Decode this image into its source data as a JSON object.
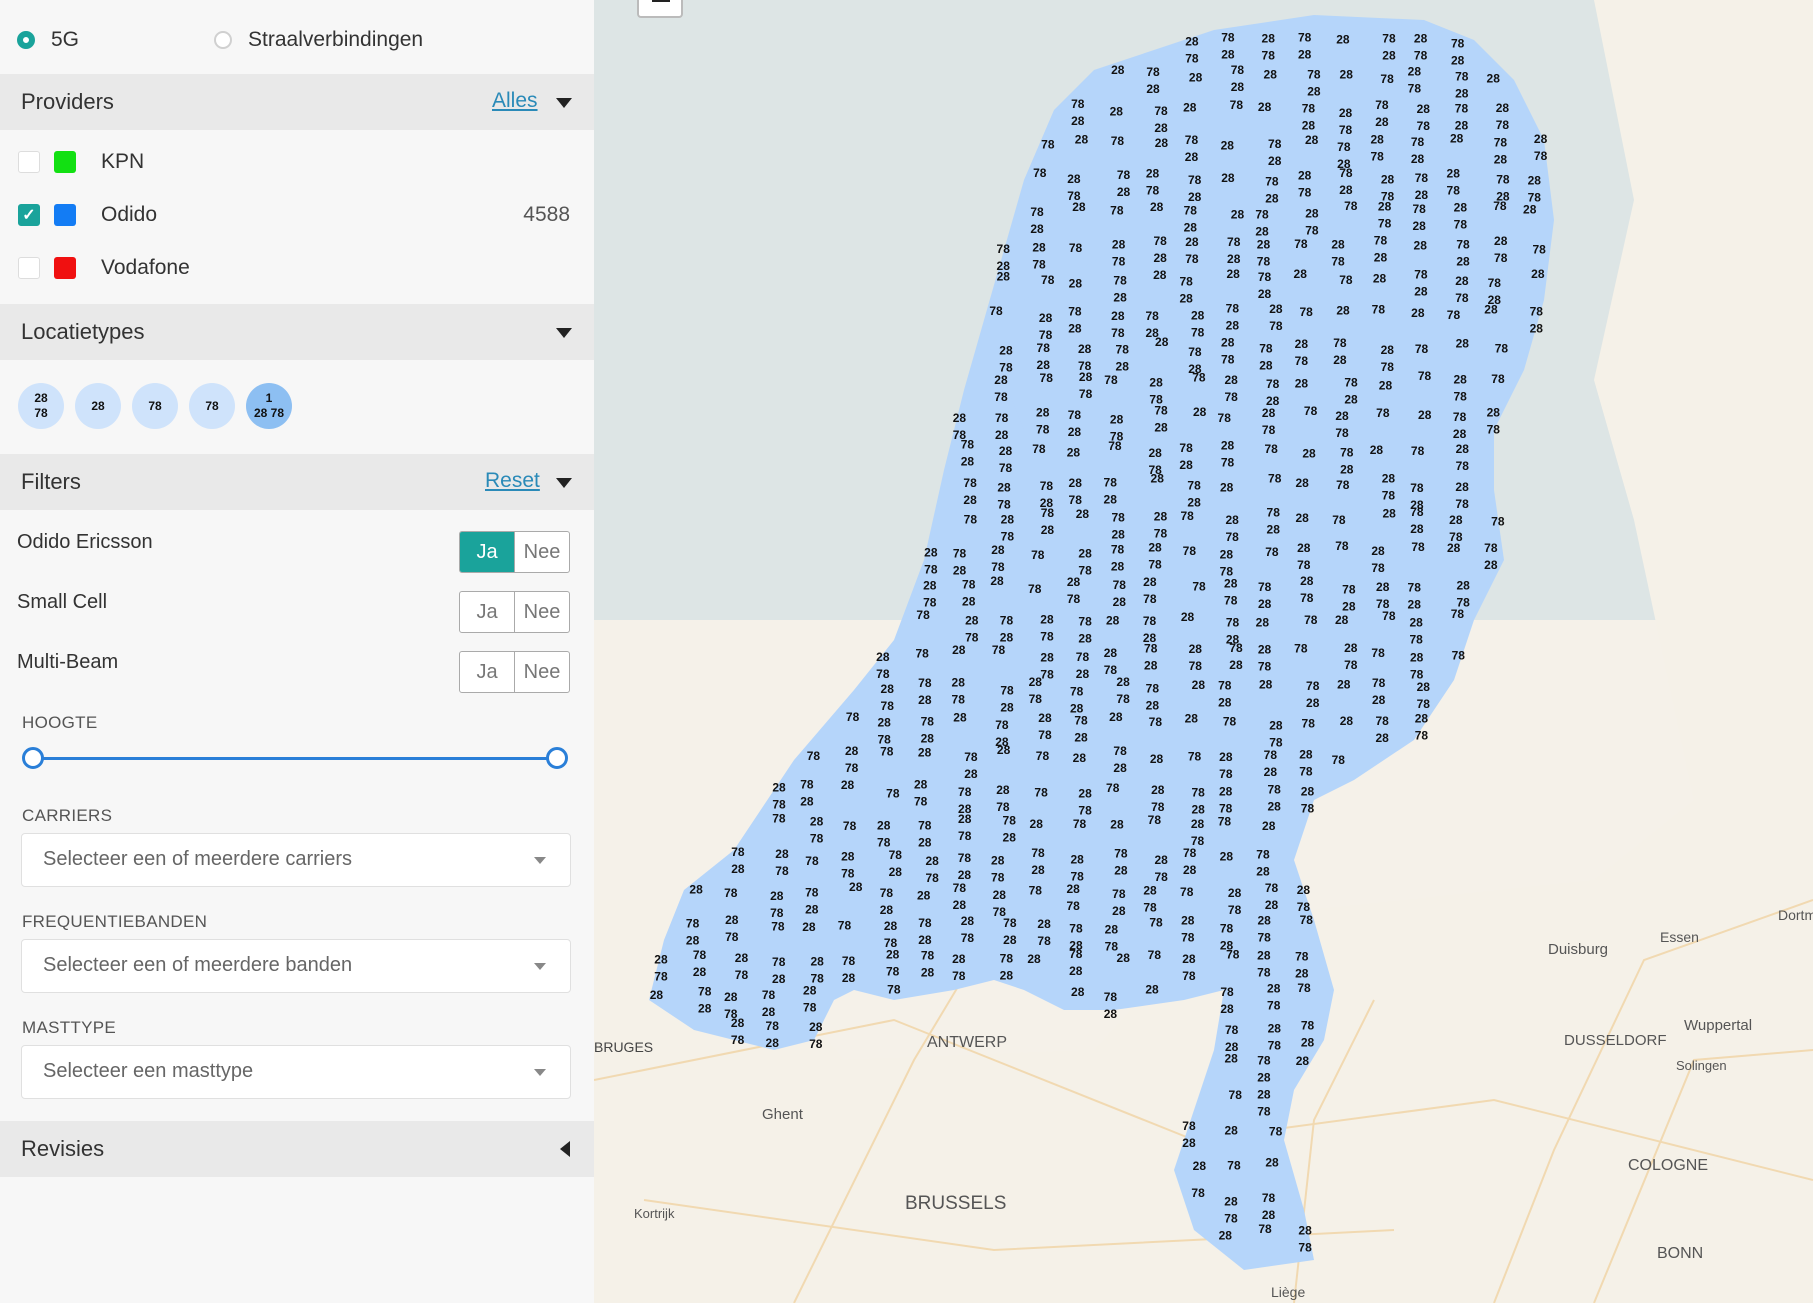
{
  "view": {
    "options": [
      "5G",
      "Straalverbindingen"
    ],
    "selected": "5G"
  },
  "providers": {
    "title": "Providers",
    "link": "Alles",
    "items": [
      {
        "label": "KPN",
        "color": "#12e012",
        "checked": false,
        "count": ""
      },
      {
        "label": "Odido",
        "color": "#137cf4",
        "checked": true,
        "count": "4588"
      },
      {
        "label": "Vodafone",
        "color": "#f01010",
        "checked": false,
        "count": ""
      }
    ]
  },
  "locatietypes": {
    "title": "Locatietypes",
    "items": [
      {
        "top": "28",
        "bottom": "78"
      },
      {
        "top": "28",
        "bottom": ""
      },
      {
        "top": "78",
        "bottom": ""
      },
      {
        "top": "78",
        "bottom": ""
      },
      {
        "top": "1",
        "bottom": "28 78"
      }
    ]
  },
  "filters": {
    "title": "Filters",
    "link": "Reset",
    "toggles": [
      {
        "label": "Odido Ericsson",
        "yes": "Ja",
        "no": "Nee",
        "value": "Ja"
      },
      {
        "label": "Small Cell",
        "yes": "Ja",
        "no": "Nee",
        "value": ""
      },
      {
        "label": "Multi-Beam",
        "yes": "Ja",
        "no": "Nee",
        "value": ""
      }
    ],
    "hoogte": {
      "label": "HOOGTE",
      "min": 0,
      "max": 1
    },
    "carriers": {
      "label": "CARRIERS",
      "placeholder": "Selecteer een of meerdere carriers"
    },
    "frequentiebanden": {
      "label": "FREQUENTIEBANDEN",
      "placeholder": "Selecteer een of meerdere banden"
    },
    "masttype": {
      "label": "MASTTYPE",
      "placeholder": "Selecteer een masttype"
    }
  },
  "revisies": {
    "title": "Revisies"
  },
  "map": {
    "cluster_color": "#b5d5fa",
    "cluster_labels": [
      "28",
      "78"
    ],
    "places": [
      "BRUGES",
      "ANTWERP",
      "Ghent",
      "BRUSSELS",
      "Kortrijk",
      "Liège",
      "Duisburg",
      "Essen",
      "Dortm",
      "Wuppertal",
      "DUSSELDORF",
      "Solingen",
      "COLOGNE",
      "BONN"
    ]
  }
}
